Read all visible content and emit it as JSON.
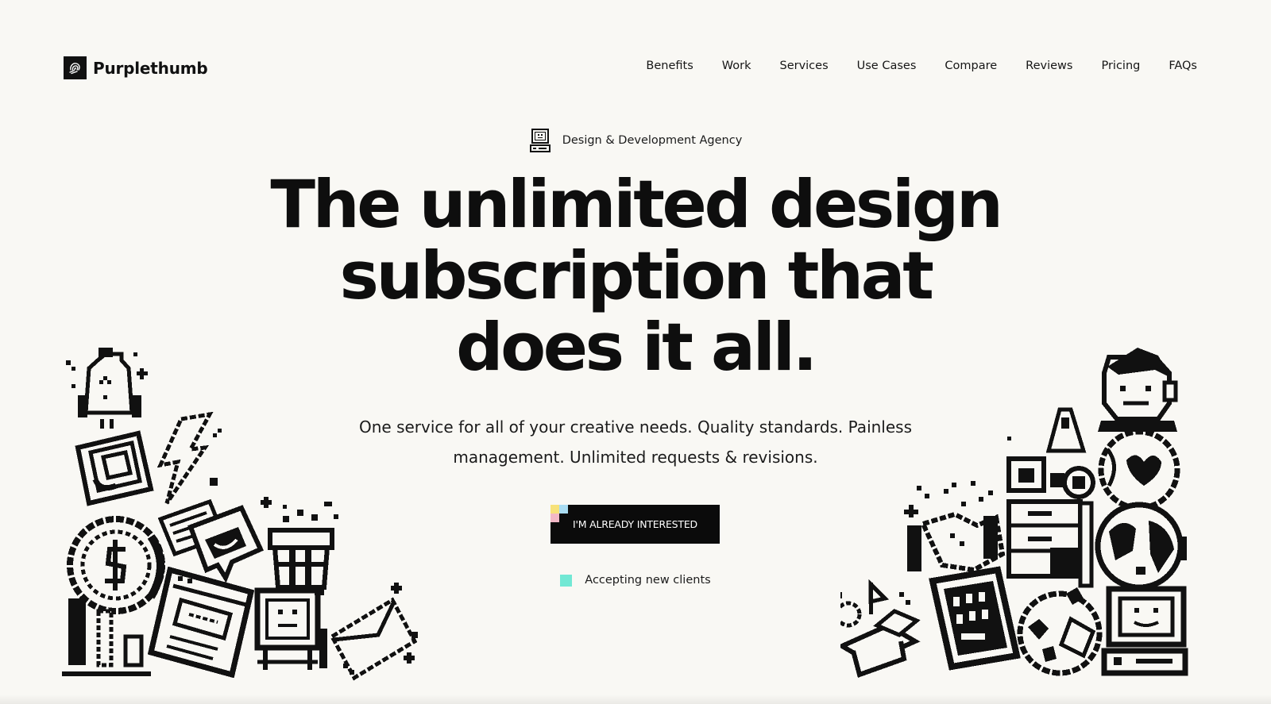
{
  "header": {
    "brand": "Purplethumb",
    "nav": [
      "Benefits",
      "Work",
      "Services",
      "Use Cases",
      "Compare",
      "Reviews",
      "Pricing",
      "FAQs"
    ]
  },
  "hero": {
    "eyebrow": "Design & Development Agency",
    "headline": [
      "The unlimited design",
      "subscription that",
      "does it all."
    ],
    "subhead": [
      "One service for all of your creative needs. Quality standards. Painless",
      "management. Unlimited requests & revisions."
    ],
    "cta_label": "I'M ALREADY INTERESTED",
    "status_text": "Accepting new clients"
  },
  "colors": {
    "background": "#f9f8f4",
    "text": "#111111",
    "cta_background": "#0b0b0b",
    "status_dot": "#72e8d4",
    "accent_yellow": "#f7e27a",
    "accent_blue": "#a9dcf2",
    "accent_pink": "#f2b8c6"
  },
  "icons": {
    "logo": "thumbprint-logo-icon",
    "eyebrow": "retro-computer-icon",
    "status": "status-square-icon",
    "illustrations": [
      "pixel-art-cluster-left",
      "pixel-art-cluster-right"
    ]
  }
}
